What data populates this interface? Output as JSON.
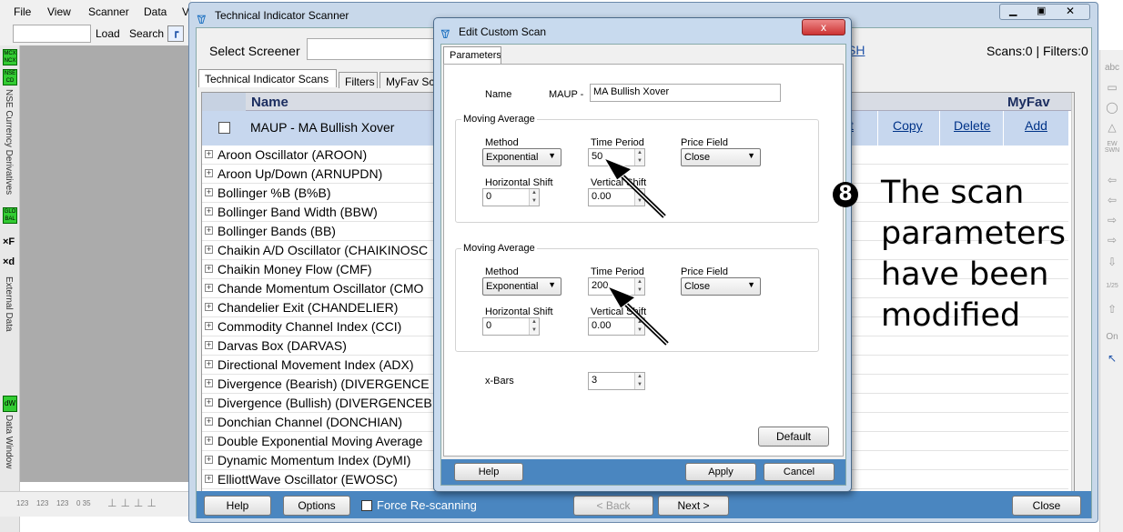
{
  "app": {
    "menu": [
      "File",
      "View",
      "Scanner",
      "Data",
      "V"
    ],
    "toolbar": {
      "load": "Load",
      "search": "Search"
    },
    "left_labels": {
      "mcx": "MCX NCX",
      "nse": "NSE CD",
      "currency": "NSE Currency Derivatives",
      "global": "GLO BAL",
      "external": "External Data",
      "dw": "dW",
      "data_window": "Data Window"
    },
    "bottom_icons": [
      "123",
      "123",
      "123",
      "0 35"
    ],
    "right_icons": [
      "abc",
      "EW SWN",
      "On",
      "1/25"
    ]
  },
  "scanner": {
    "title": "Technical Indicator Scanner",
    "select_screener_label": "Select Screener",
    "partial_link": "SH",
    "scans_label": "Scans:0 | Filters:0",
    "tabs": [
      "Technical Indicator Scans",
      "Filters",
      "MyFav Sca"
    ],
    "columns": {
      "name": "Name",
      "myfav": "MyFav"
    },
    "selected_scan": {
      "name": "MAUP - MA Bullish Xover",
      "partial_link": "t",
      "copy": "Copy",
      "delete": "Delete",
      "add": "Add"
    },
    "indicators": [
      "Aroon Oscillator (AROON)",
      "Aroon Up/Down (ARNUPDN)",
      "Bollinger %B (B%B)",
      "Bollinger Band Width (BBW)",
      "Bollinger Bands (BB)",
      "Chaikin A/D Oscillator (CHAIKINOSC",
      "Chaikin Money Flow (CMF)",
      "Chande Momentum Oscillator (CMO",
      "Chandelier Exit (CHANDELIER)",
      "Commodity Channel Index (CCI)",
      "Darvas Box (DARVAS)",
      "Directional Movement Index (ADX)",
      "Divergence (Bearish) (DIVERGENCE",
      "Divergence (Bullish) (DIVERGENCEB",
      "Donchian Channel (DONCHIAN)",
      "Double Exponential Moving Average",
      "Dynamic Momentum Index (DyMI)",
      "ElliottWave Oscillator (EWOSC)"
    ],
    "footer": {
      "help": "Help",
      "options": "Options",
      "force_rescan": "Force Re-scanning",
      "back": "< Back",
      "next": "Next >",
      "close": "Close"
    }
  },
  "dialog": {
    "title": "Edit Custom Scan",
    "close_glyph": "x",
    "tab": "Parameters",
    "name_label": "Name",
    "name_prefix": "MAUP -",
    "name_value": "MA Bullish Xover",
    "ma1": {
      "group": "Moving Average",
      "method_label": "Method",
      "method": "Exponential",
      "period_label": "Time Period",
      "period": "50",
      "price_label": "Price Field",
      "price": "Close",
      "hshift_label": "Horizontal Shift",
      "hshift": "0",
      "vshift_label": "Vertical Shift",
      "vshift": "0.00"
    },
    "ma2": {
      "group": "Moving Average",
      "method_label": "Method",
      "method": "Exponential",
      "period_label": "Time Period",
      "period": "200",
      "price_label": "Price Field",
      "price": "Close",
      "hshift_label": "Horizontal Shift",
      "hshift": "0",
      "vshift_label": "Vertical Shift",
      "vshift": "0.00"
    },
    "xbars_label": "x-Bars",
    "xbars": "3",
    "default_btn": "Default",
    "help_btn": "Help",
    "apply_btn": "Apply",
    "cancel_btn": "Cancel"
  },
  "annotation": {
    "step": "8",
    "text_line1": "The scan",
    "text_line2": "parameters",
    "text_line3": "have been",
    "text_line4": "modified"
  }
}
